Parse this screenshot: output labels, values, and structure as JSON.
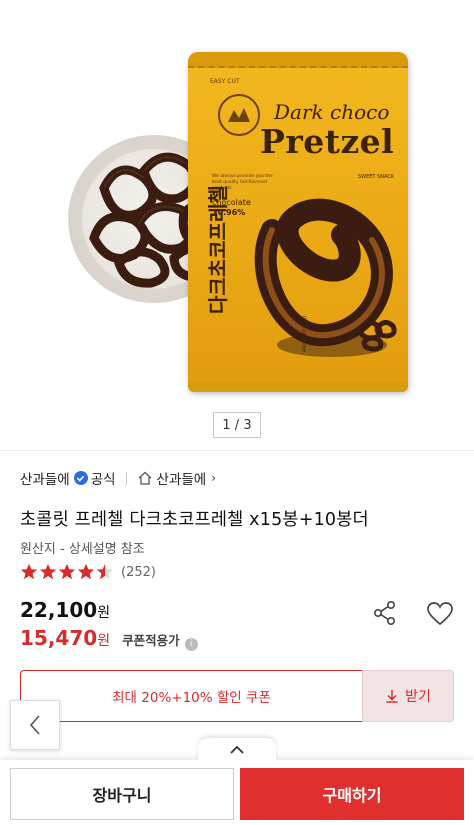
{
  "gallery": {
    "pager": "1 / 3",
    "package": {
      "easy_cut": "EASY CUT",
      "title_line1": "Dark choco",
      "title_line2": "Pretzel",
      "tagline": "We always provide you the best quality full-flavored products",
      "sweet_snack": "SWEET SNACK",
      "chocolate_label": "chocolate",
      "chocolate_pct": "70.96%",
      "korean_name": "다크초코프레첼",
      "net_info": "40g (200 kcal)"
    }
  },
  "brand": {
    "name": "산과들에",
    "official": "공식",
    "store_link": "산과들에"
  },
  "product": {
    "title": "초콜릿 프레첼 다크초코프레첼 x15봉+10봉더",
    "origin": "원산지 - 상세설명 참조",
    "rating": 4.5,
    "review_count": "(252)"
  },
  "pricing": {
    "original_price": "22,100",
    "original_unit": "원",
    "coupon_price": "15,470",
    "coupon_unit": "원",
    "coupon_applied": "쿠폰적용가",
    "info_symbol": "i"
  },
  "coupon": {
    "text": "최대 20%+10% 할인 쿠폰",
    "download": "받기"
  },
  "bottom": {
    "cart": "장바구니",
    "buy": "구매하기"
  },
  "colors": {
    "accent": "#e02f2f",
    "verified": "#2a6de0",
    "bag": "#eaa915"
  }
}
